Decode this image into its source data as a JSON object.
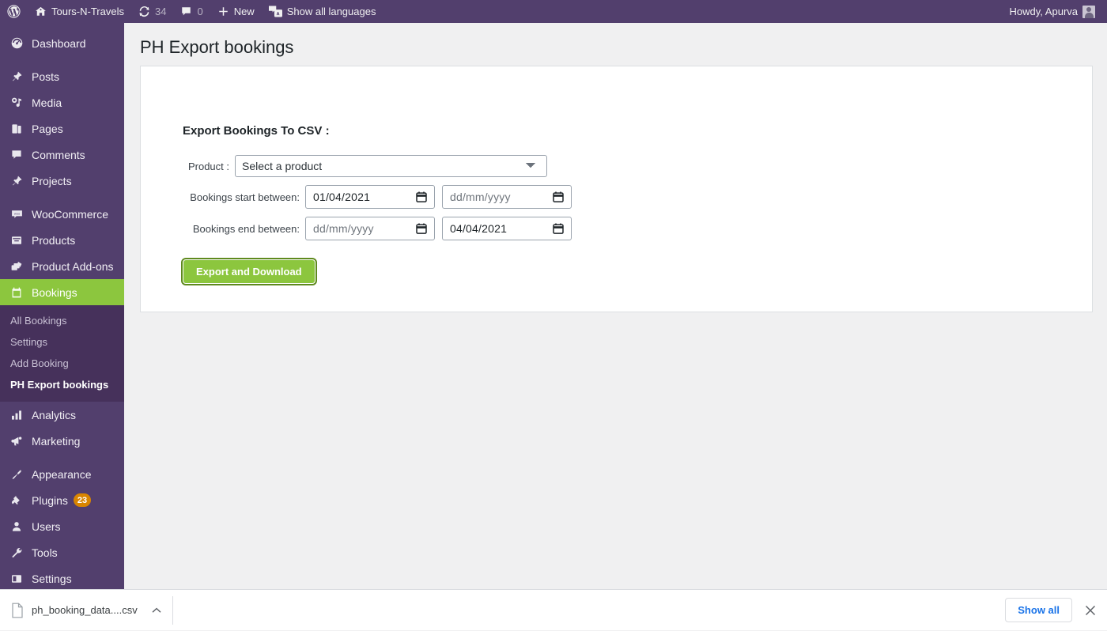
{
  "adminbar": {
    "wp_logo": "wordpress-logo-icon",
    "site_name": "Tours-N-Travels",
    "updates_count": "34",
    "comments_count": "0",
    "new_label": "New",
    "languages_label": "Show all languages",
    "howdy": "Howdy, Apurva"
  },
  "sidebar": {
    "items": [
      {
        "label": "Dashboard",
        "icon": "dashboard-icon",
        "gap_before": true
      },
      {
        "label": "Posts",
        "icon": "pin-icon",
        "gap_before": true
      },
      {
        "label": "Media",
        "icon": "media-icon"
      },
      {
        "label": "Pages",
        "icon": "pages-icon"
      },
      {
        "label": "Comments",
        "icon": "comment-icon"
      },
      {
        "label": "Projects",
        "icon": "pin-icon"
      },
      {
        "label": "WooCommerce",
        "icon": "woocommerce-icon",
        "gap_before": true
      },
      {
        "label": "Products",
        "icon": "products-icon"
      },
      {
        "label": "Product Add-ons",
        "icon": "product-addons-icon"
      },
      {
        "label": "Bookings",
        "icon": "calendar-icon",
        "current": true
      },
      {
        "label": "Analytics",
        "icon": "analytics-icon",
        "gap_before": true
      },
      {
        "label": "Marketing",
        "icon": "megaphone-icon"
      },
      {
        "label": "Appearance",
        "icon": "appearance-icon",
        "gap_before": true
      },
      {
        "label": "Plugins",
        "icon": "plugins-icon",
        "badge": "23"
      },
      {
        "label": "Users",
        "icon": "users-icon"
      },
      {
        "label": "Tools",
        "icon": "tools-icon"
      },
      {
        "label": "Settings",
        "icon": "settings-icon"
      }
    ],
    "submenu": [
      {
        "label": "All Bookings"
      },
      {
        "label": "Settings"
      },
      {
        "label": "Add Booking"
      },
      {
        "label": "PH Export bookings",
        "active": true
      }
    ]
  },
  "main": {
    "page_title": "PH Export bookings",
    "form_heading": "Export Bookings To CSV :",
    "product_label": "Product :",
    "product_selected": "Select a product",
    "start_label": "Bookings start between:",
    "start_from": "01/04/2021",
    "start_to": "dd/mm/yyyy",
    "end_label": "Bookings end between:",
    "end_from": "dd/mm/yyyy",
    "end_to": "04/04/2021",
    "export_button": "Export and Download"
  },
  "downloadbar": {
    "file_name": "ph_booking_data....csv",
    "show_all": "Show all",
    "file_icon": "file-icon",
    "caret_icon": "chevron-up-icon",
    "close_icon": "close-icon"
  },
  "colors": {
    "admin_purple": "#523f6d",
    "submenu_purple": "#46315b",
    "accent_green": "#8cc63e",
    "badge_orange": "#d98500",
    "link_blue": "#1a73e8"
  }
}
